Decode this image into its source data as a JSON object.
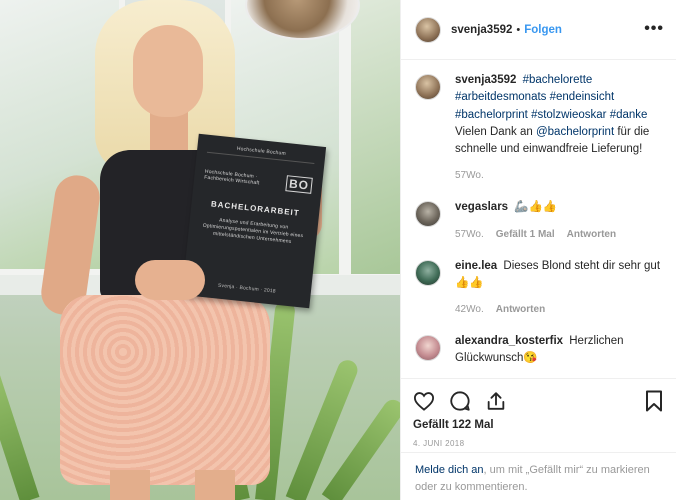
{
  "post": {
    "author": "svenja3592",
    "follow_label": "Folgen",
    "dot": "•",
    "more_glyph": "•••",
    "caption": {
      "tags_line1": "#bachelorette",
      "tags_line2": "#arbeitdesmonats #endeinsicht",
      "tags_line3": "#bachelorprint #stolzwieoskar #danke",
      "text_before": "Vielen Dank an ",
      "mention": "@bachelorprint",
      "text_after": " für die schnelle und einwandfreie Lieferung!",
      "time": "57Wo."
    },
    "likes_label": "Gefällt 122 Mal",
    "date": "4. JUNI 2018"
  },
  "book": {
    "top_text": "Hochschule Bochum",
    "logo": "BO",
    "side_text": "Hochschule Bochum · Fachbereich Wirtschaft",
    "title": "BACHELORARBEIT",
    "small_text": "Analyse und Erarbeitung von Optimierungspotentialen im Vertrieb eines mittelständischen Unternehmens",
    "footer": "Svenja · Bochum · 2018"
  },
  "comments": [
    {
      "user": "vegaslars",
      "text": "🦾👍👍",
      "time": "57Wo.",
      "likes": "Gefällt 1 Mal",
      "reply": "Antworten"
    },
    {
      "user": "eine.lea",
      "text": "Dieses Blond steht dir sehr gut 👍👍",
      "time": "42Wo.",
      "reply": "Antworten"
    },
    {
      "user": "alexandra_kosterfix",
      "text": "Herzlichen Glückwunsch😘"
    }
  ],
  "login": {
    "link": "Melde dich an",
    "rest": ", um mit „Gefällt mir“ zu markieren oder zu kommentieren."
  },
  "icons": [
    "heart-icon",
    "comment-icon",
    "share-icon",
    "bookmark-icon"
  ]
}
